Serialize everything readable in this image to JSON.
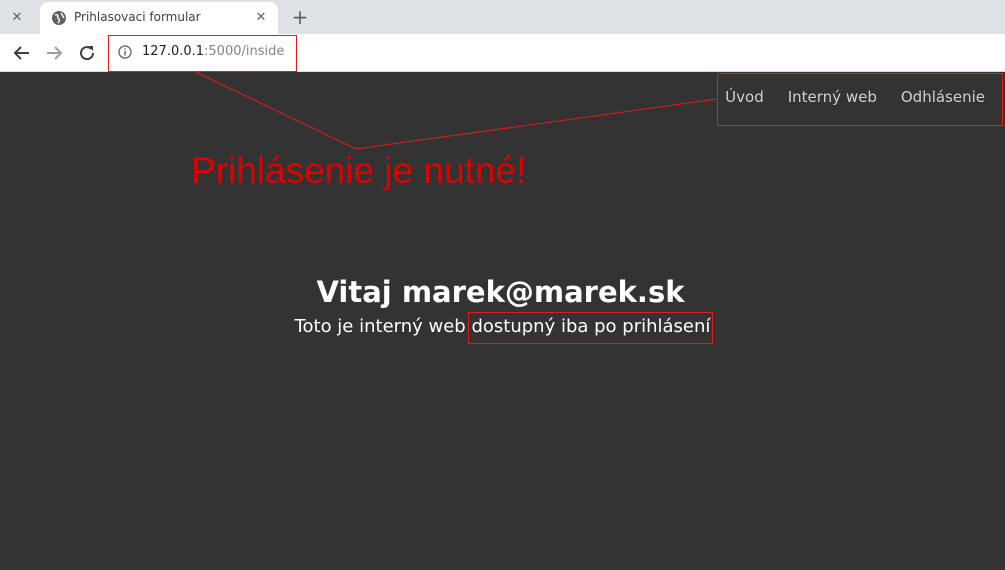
{
  "browser": {
    "tab_title": "Prihlasovaci formular",
    "url_host": "127.0.0.1",
    "url_path": ":5000/inside"
  },
  "nav": {
    "items": [
      "Úvod",
      "Interný web",
      "Odhlásenie"
    ]
  },
  "main": {
    "welcome": "Vitaj marek@marek.sk",
    "subtitle_prefix": "Toto je interný web ",
    "subtitle_highlight": "dostupný iba po prihlásení"
  },
  "annotation": {
    "text": "Prihlásenie je nutné!",
    "color": "#e31b1b"
  },
  "colors": {
    "background": "#333333",
    "tabbar": "#dee1e6"
  }
}
